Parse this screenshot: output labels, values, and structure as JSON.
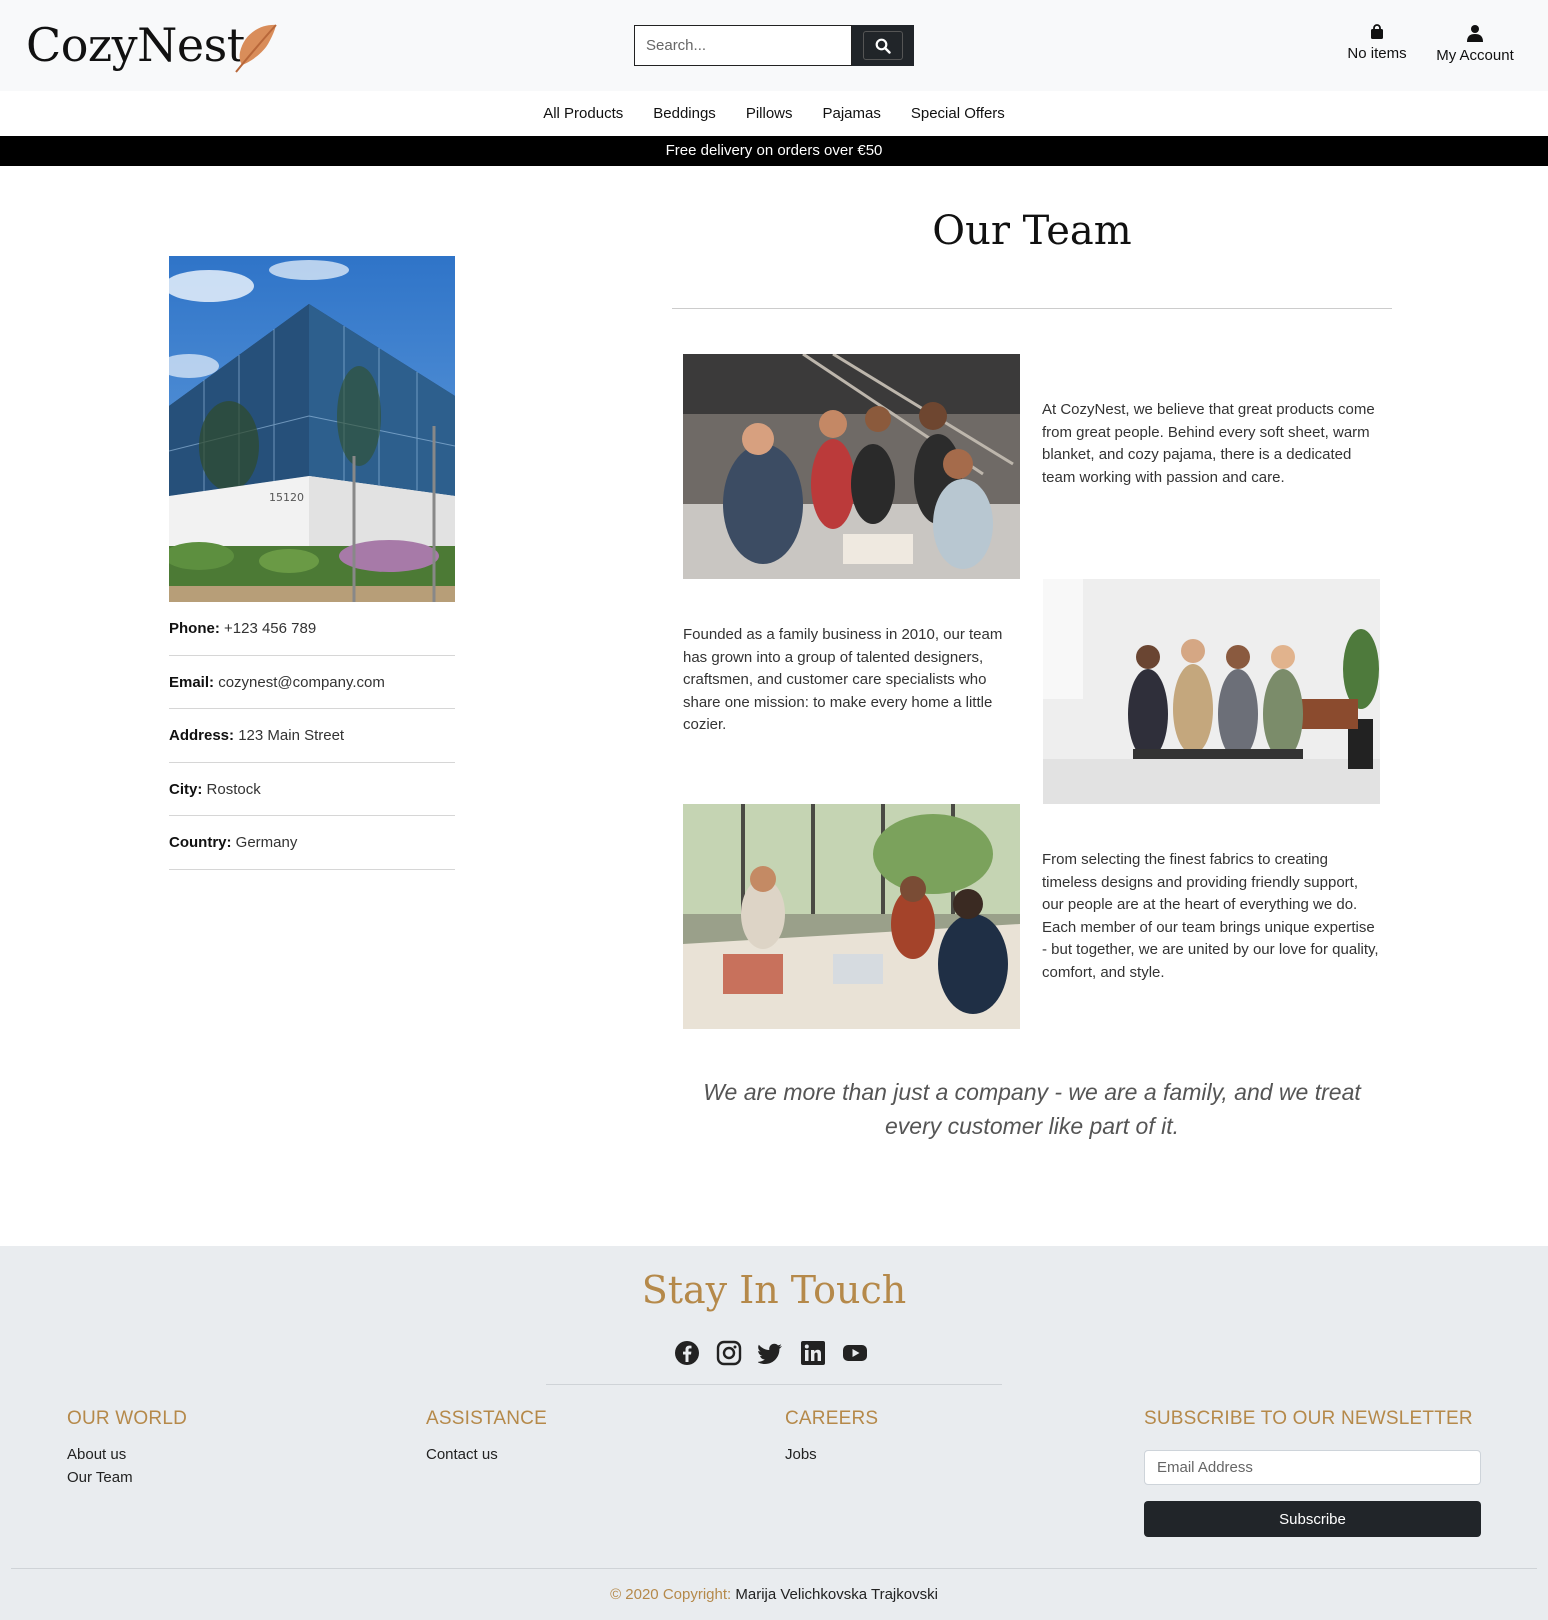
{
  "header": {
    "logo": "CozyNest",
    "search_placeholder": "Search...",
    "cart_label": "No items",
    "account_label": "My Account"
  },
  "nav": [
    "All Products",
    "Beddings",
    "Pillows",
    "Pajamas",
    "Special Offers"
  ],
  "promo": "Free delivery on orders over €50",
  "contact": [
    {
      "label": "Phone:",
      "value": "+123 456 789"
    },
    {
      "label": "Email:",
      "value": "cozynest@company.com"
    },
    {
      "label": "Address:",
      "value": "123 Main Street"
    },
    {
      "label": "City:",
      "value": "Rostock"
    },
    {
      "label": "Country:",
      "value": "Germany"
    }
  ],
  "building_number": "15120",
  "team": {
    "title": "Our Team",
    "paragraphs": [
      "At CozyNest, we believe that great products come from great people. Behind every soft sheet, warm blanket, and cozy pajama, there is a dedicated team working with passion and care.",
      "Founded as a family business in 2010, our team has grown into a group of talented designers, craftsmen, and customer care specialists who share one mission: to make every home a little cozier.",
      "From selecting the finest fabrics to creating timeless designs and providing friendly support, our people are at the heart of everything we do. Each member of our team brings unique expertise - but together, we are united by our love for quality, comfort, and style."
    ],
    "quote": "We are more than just a company - we are a family, and we treat every customer like part of it."
  },
  "footer": {
    "heading": "Stay In Touch",
    "socials": [
      "facebook-icon",
      "instagram-icon",
      "twitter-icon",
      "linkedin-icon",
      "youtube-icon"
    ],
    "columns": [
      {
        "title": "OUR WORLD",
        "links": [
          "About us",
          "Our Team"
        ]
      },
      {
        "title": "ASSISTANCE",
        "links": [
          "Contact us"
        ]
      },
      {
        "title": "CAREERS",
        "links": [
          "Jobs"
        ]
      }
    ],
    "newsletter": {
      "title": "SUBSCRIBE TO OUR NEWSLETTER",
      "placeholder": "Email Address",
      "button": "Subscribe"
    },
    "copyright_prefix": "© 2020 Copyright:",
    "copyright_name": "Marija Velichkovska Trajkovski"
  },
  "colors": {
    "accent": "#b5894a",
    "dark": "#212529",
    "footer_bg": "#e9ecef"
  }
}
